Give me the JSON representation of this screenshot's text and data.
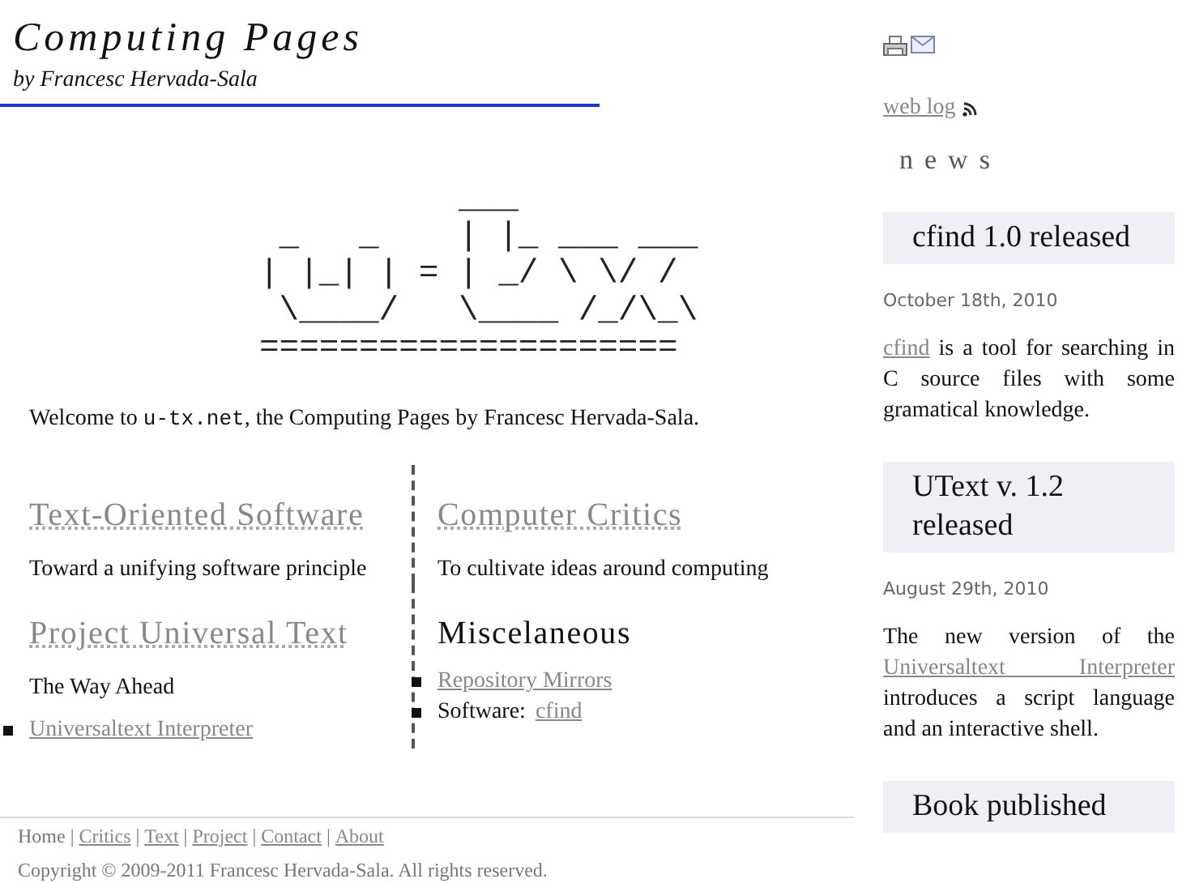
{
  "header": {
    "title": "Computing Pages",
    "subtitle": "by Francesc Hervada-Sala"
  },
  "logo_art": "          ___\n _   _    | |_ ___ ___\n| |_| | = | _/ \\ \\/ /\n \\____/   \\____ /_/\\_\\\n=====================",
  "welcome": [
    {
      "text": "Welcome to "
    },
    {
      "code": "u-tx.net"
    },
    {
      "text": ", the Computing Pages by Francesc Hervada-Sala."
    }
  ],
  "sections": [
    {
      "title": "Text-Oriented Software",
      "linked": true,
      "description": "Toward a unifying software principle"
    },
    {
      "title": "Computer Critics",
      "linked": true,
      "description": "To cultivate ideas around computing"
    },
    {
      "title": "Project Universal Text",
      "linked": true,
      "description": "The Way Ahead",
      "items": [
        {
          "link": "Universaltext Interpreter"
        }
      ]
    },
    {
      "title": "Miscelaneous",
      "linked": false,
      "items": [
        {
          "link": "Repository Mirrors"
        },
        {
          "text": "Software: ",
          "link": "cfind"
        }
      ]
    }
  ],
  "footer": {
    "separator": "|",
    "links": [
      {
        "label": "Home",
        "linked": false
      },
      {
        "label": "Critics",
        "linked": true
      },
      {
        "label": "Text",
        "linked": true
      },
      {
        "label": "Project",
        "linked": true
      },
      {
        "label": "Contact",
        "linked": true
      },
      {
        "label": "About",
        "linked": true
      }
    ],
    "copyright": "Copyright © 2009-2011 Francesc Hervada-Sala. All rights reserved."
  },
  "sidebar": {
    "weblog": "web log",
    "news_heading": "news",
    "news": [
      {
        "title": "cfind 1.0 released",
        "date": "October 18th, 2010",
        "body": [
          {
            "link": "cfind"
          },
          {
            "text": " is a tool for searching in C source files with some gramatical knowledge."
          }
        ]
      },
      {
        "title": "UText v. 1.2 released",
        "date": "August 29th, 2010",
        "body": [
          {
            "text": "The new version of the "
          },
          {
            "link": "Universaltext Interpreter"
          },
          {
            "text": " introduces a script language and an interactive shell."
          }
        ]
      },
      {
        "title": "Book published"
      }
    ]
  }
}
